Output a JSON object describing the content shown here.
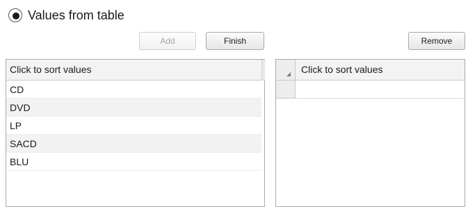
{
  "option": {
    "label": "Values from table",
    "selected": true
  },
  "buttons": {
    "add": "Add",
    "finish": "Finish",
    "remove": "Remove"
  },
  "left_table": {
    "header": "Click to sort values",
    "rows": [
      "CD",
      "DVD",
      "LP",
      "SACD",
      "BLU"
    ]
  },
  "right_table": {
    "header": "Click to sort values",
    "rows": [
      ""
    ]
  }
}
